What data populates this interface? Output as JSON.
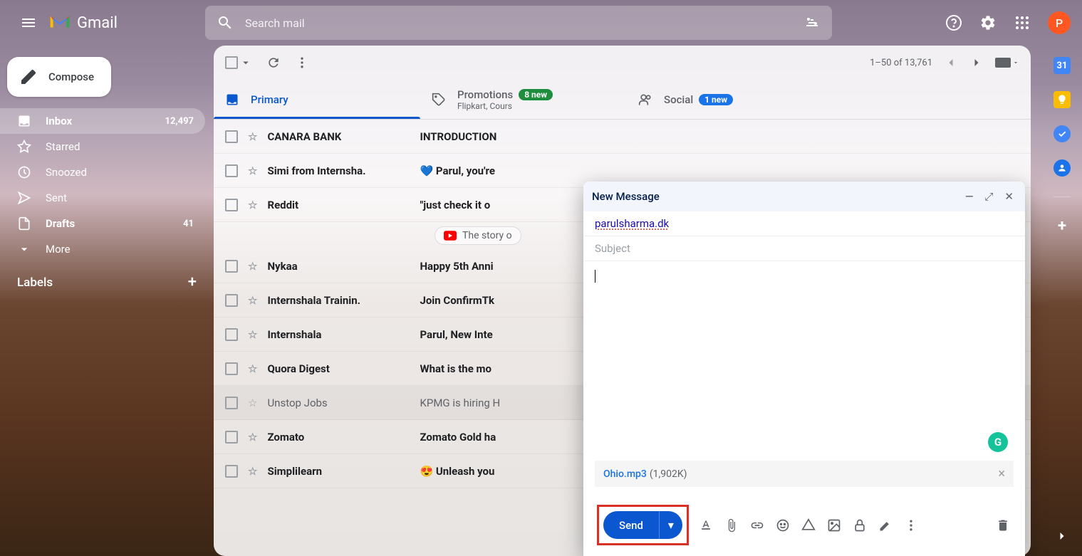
{
  "header": {
    "app_name": "Gmail",
    "search_placeholder": "Search mail",
    "avatar_initial": "P"
  },
  "sidebar": {
    "compose_label": "Compose",
    "items": [
      {
        "label": "Inbox",
        "count": "12,497",
        "active": true
      },
      {
        "label": "Starred",
        "count": ""
      },
      {
        "label": "Snoozed",
        "count": ""
      },
      {
        "label": "Sent",
        "count": ""
      },
      {
        "label": "Drafts",
        "count": "41"
      },
      {
        "label": "More",
        "count": ""
      }
    ],
    "labels_heading": "Labels"
  },
  "toolbar": {
    "pagination": "1–50 of 13,761"
  },
  "tabs": [
    {
      "label": "Primary",
      "badge": "",
      "sub": ""
    },
    {
      "label": "Promotions",
      "badge": "8 new",
      "badge_class": "green",
      "sub": "Flipkart, Cours"
    },
    {
      "label": "Social",
      "badge": "1 new",
      "badge_class": "blue",
      "sub": ""
    }
  ],
  "emails": [
    {
      "sender": "CANARA BANK",
      "subject": "INTRODUCTION",
      "unread": true
    },
    {
      "sender": "Simi from Internsha.",
      "subject": "💙 Parul, you're",
      "unread": true
    },
    {
      "sender": "Reddit",
      "subject": "\"just check it o",
      "unread": true
    },
    {
      "sender": "Nykaa",
      "subject": "Happy 5th Anni",
      "unread": true
    },
    {
      "sender": "Internshala Trainin.",
      "subject": "Join ConfirmTk",
      "unread": true
    },
    {
      "sender": "Internshala",
      "subject": "Parul, New Inte",
      "unread": true
    },
    {
      "sender": "Quora Digest",
      "subject": "What is the mo",
      "unread": true
    },
    {
      "sender": "Unstop Jobs",
      "subject": "KPMG is hiring H",
      "unread": false
    },
    {
      "sender": "Zomato",
      "subject": "Zomato Gold ha",
      "unread": true
    },
    {
      "sender": "Simplilearn",
      "subject": "😍 Unleash you",
      "unread": true
    }
  ],
  "chip": {
    "label": "The story o"
  },
  "compose": {
    "title": "New Message",
    "to": "parulsharma.dk",
    "subject_placeholder": "Subject",
    "attachment": {
      "name": "Ohio.mp3",
      "size": "(1,902K)"
    },
    "send_label": "Send"
  }
}
